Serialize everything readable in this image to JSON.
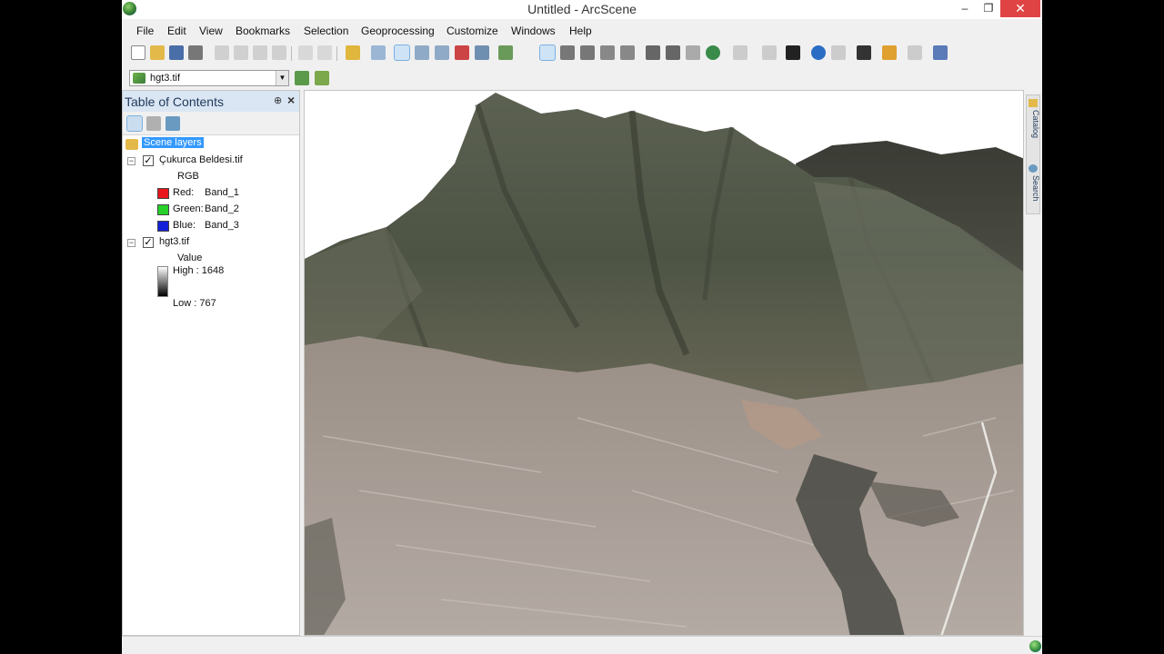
{
  "window": {
    "title": "Untitled - ArcScene",
    "min_glyph": "–",
    "max_glyph": "❐",
    "close_glyph": "✕"
  },
  "menu": [
    "File",
    "Edit",
    "View",
    "Bookmarks",
    "Selection",
    "Geoprocessing",
    "Customize",
    "Windows",
    "Help"
  ],
  "toolbar": {
    "icons": [
      "new-document-icon",
      "open-icon",
      "save-icon",
      "print-icon",
      "cut-icon",
      "copy-icon",
      "paste-icon",
      "delete-icon",
      "undo-icon",
      "redo-icon",
      "add-data-icon",
      "scene-properties-icon",
      "view-icon",
      "layout-icon",
      "animation-icon",
      "record-icon",
      "fullscreen-icon",
      "navigate-icon",
      "fly-icon",
      "target-center-icon",
      "zoom-to-target-icon",
      "set-observer-icon",
      "zoom-in-icon",
      "zoom-out-icon",
      "pan-icon",
      "full-extent-icon",
      "select-features-icon",
      "identify-icon",
      "measure-icon",
      "find-icon",
      "attributes-icon",
      "arccatalog-icon",
      "arctoolbox-icon"
    ],
    "layer_combo_value": "hgt3.tif"
  },
  "toc": {
    "title": "Table of Contents",
    "pin_glyph": "⊕",
    "close_glyph": "×",
    "root_label": "Scene layers",
    "layers": [
      {
        "name": "Çukurca Beldesi.tif",
        "checked": true,
        "renderer": "RGB",
        "bands": [
          {
            "channel": "Red:",
            "band": "Band_1",
            "color": "#e8161b"
          },
          {
            "channel": "Green:",
            "band": "Band_2",
            "color": "#27d12a"
          },
          {
            "channel": "Blue:",
            "band": "Band_3",
            "color": "#1420d8"
          }
        ]
      },
      {
        "name": "hgt3.tif",
        "checked": true,
        "renderer": "Value",
        "high": "High : 1648",
        "low": "Low : 767"
      }
    ]
  },
  "dock": {
    "tabs": [
      "Catalog",
      "Search"
    ]
  },
  "colors": {
    "titlebar_close": "#e04343",
    "toc_header": "#dbe6f4",
    "selection": "#3399ff"
  }
}
